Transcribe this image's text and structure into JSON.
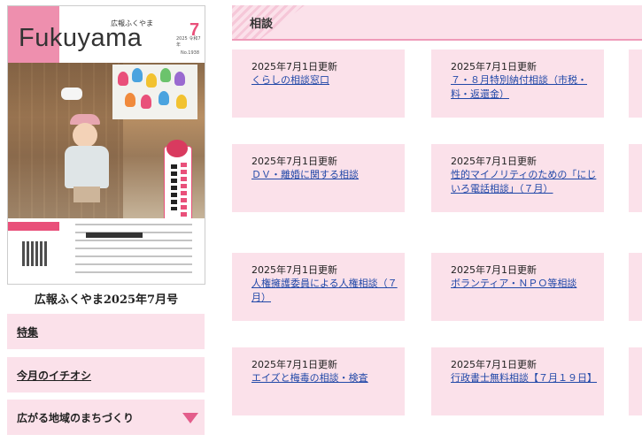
{
  "cover": {
    "brand": "Fukuyama",
    "kanji_title": "広報ふくやま",
    "issue_number": "7",
    "year_text": "2025 令和7年",
    "no_text": "No.1938",
    "caption": "広報ふくやま2025年7月号"
  },
  "sidebar": {
    "items": [
      {
        "label": "特集"
      },
      {
        "label": "今月のイチオシ"
      },
      {
        "label": "広がる地域のまちづくり"
      }
    ]
  },
  "section": {
    "title": "相談"
  },
  "cards": [
    {
      "date": "2025年7月1日更新",
      "link": "くらしの相談窓口"
    },
    {
      "date": "2025年7月1日更新",
      "link": "７・８月特別納付相談（市税・料・返還金）"
    },
    {
      "date": "2025年7月1日更新",
      "link": "ＤＶ・離婚に関する相談"
    },
    {
      "date": "2025年7月1日更新",
      "link": "性的マイノリティのための「にじいろ電話相談」（７月）"
    },
    {
      "date": "2025年7月1日更新",
      "link": "人権擁護委員による人権相談（７月）"
    },
    {
      "date": "2025年7月1日更新",
      "link": "ボランティア・ＮＰＯ等相談"
    },
    {
      "date": "2025年7月1日更新",
      "link": "エイズと梅毒の相談・検査"
    },
    {
      "date": "2025年7月1日更新",
      "link": "行政書士無料相談【７月１９日】"
    }
  ],
  "colors": {
    "pink_bg": "#fbe1ea",
    "accent": "#e35d8b",
    "link": "#2148a8"
  }
}
